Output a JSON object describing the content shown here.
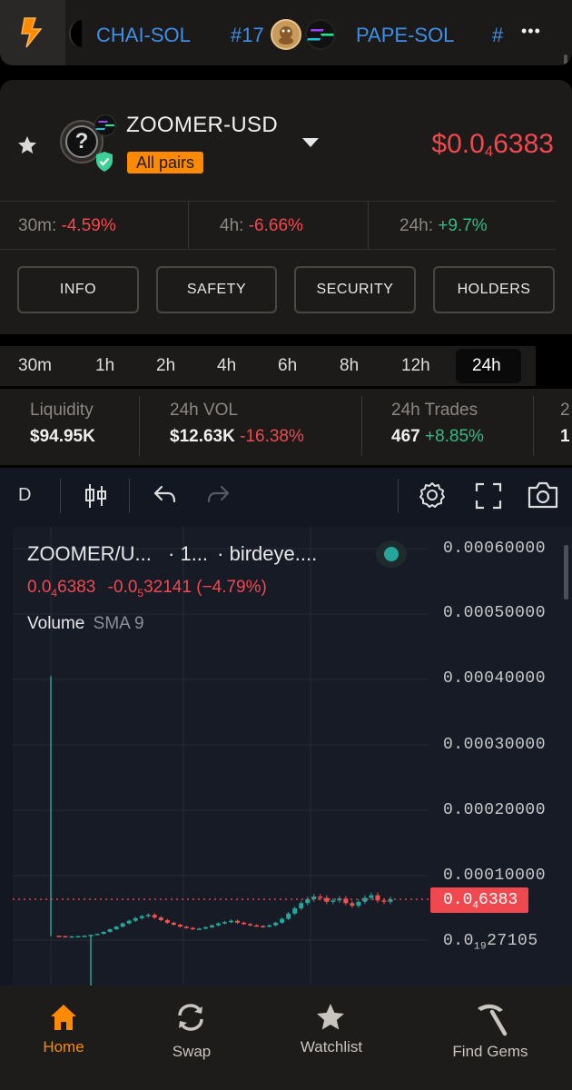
{
  "ticker": {
    "items": [
      {
        "label": "CHAI-SOL"
      },
      {
        "label": "#17"
      },
      {
        "label": "PAPE-SOL"
      },
      {
        "label": "#"
      }
    ],
    "more_label": "•••"
  },
  "pair": {
    "name": "ZOOMER-USD",
    "tag": "All pairs",
    "price": "$0.0",
    "price_sub": "4",
    "price_tail": "6383",
    "avatar_symbol": "?"
  },
  "changes": [
    {
      "label": "30m:",
      "value": "-4.59%",
      "dir": "down"
    },
    {
      "label": "4h:",
      "value": "-6.66%",
      "dir": "down"
    },
    {
      "label": "24h:",
      "value": "+9.7%",
      "dir": "up"
    }
  ],
  "actions": [
    "INFO",
    "SAFETY",
    "SECURITY",
    "HOLDERS"
  ],
  "timeframes": [
    "30m",
    "1h",
    "2h",
    "4h",
    "6h",
    "8h",
    "12h",
    "24h"
  ],
  "active_timeframe": "24h",
  "stats": [
    {
      "label": "Liquidity",
      "value": "$94.95K",
      "change": ""
    },
    {
      "label": "24h VOL",
      "value": "$12.63K",
      "change": "-16.38%",
      "dir": "down"
    },
    {
      "label": "24h Trades",
      "value": "467",
      "change": "+8.85%",
      "dir": "up"
    },
    {
      "label": "2",
      "value": "1",
      "change": ""
    }
  ],
  "chart_toolbar": {
    "interval": "D"
  },
  "chart_legend": {
    "symbol": "ZOOMER/U...",
    "interval": "· 1...",
    "source": "· birdeye....",
    "price": "0.0",
    "price_sub": "4",
    "price_tail": "6383",
    "change": "-0.0",
    "change_sub": "5",
    "change_tail": "32141 (−4.79%)",
    "volume_label": "Volume",
    "volume_indicator": "SMA 9"
  },
  "chart_data": {
    "type": "candlestick",
    "y_ticks": [
      "0.00060000",
      "0.00050000",
      "0.00040000",
      "0.00030000",
      "0.00020000",
      "0.00010000"
    ],
    "ylim": [
      7.9e-06,
      0.0006
    ],
    "last_price_label": {
      "main": "0.0",
      "sub": "4",
      "tail": "6383"
    },
    "last_price_value": 6.38e-05,
    "low_label": {
      "main": "0.0",
      "sub": "19",
      "tail": "27105"
    },
    "up_color": "#26a69a",
    "down_color": "#ef5350",
    "wick_high": 0.000405,
    "wick_low": -4e-05,
    "series": [
      8e-06,
      7.5e-06,
      7e-06,
      7.2e-06,
      7.5e-06,
      8.2e-06,
      9.5e-06,
      1.1e-05,
      1.4e-05,
      1.8e-05,
      2.2e-05,
      2.7e-05,
      3.1e-05,
      3.5e-05,
      3.8e-05,
      4e-05,
      3.6e-05,
      3.2e-05,
      2.8e-05,
      2.5e-05,
      2.2e-05,
      2e-05,
      1.8e-05,
      1.9e-05,
      2.1e-05,
      2.4e-05,
      2.7e-05,
      2.9e-05,
      3.1e-05,
      2.8e-05,
      2.6e-05,
      2.4e-05,
      2.3e-05,
      2.2e-05,
      2.4e-05,
      2.8e-05,
      3.4e-05,
      4.2e-05,
      5e-05,
      5.8e-05,
      6.4e-05,
      6.8e-05,
      6.6e-05,
      6e-05,
      6.2e-05,
      6.5e-05,
      5.8e-05,
      5.4e-05,
      6e-05,
      6.6e-05,
      7e-05,
      6.2e-05,
      6e-05,
      6.4e-05
    ]
  },
  "colors": {
    "red": "#f0484f",
    "green": "#2ebd85",
    "orange": "#ff8a00",
    "blue": "#3d8fe8"
  },
  "nav": [
    {
      "label": "Home",
      "icon": "home-icon",
      "active": true
    },
    {
      "label": "Swap",
      "icon": "swap-icon",
      "active": false
    },
    {
      "label": "Watchlist",
      "icon": "star-icon",
      "active": false
    },
    {
      "label": "Find Gems",
      "icon": "pickaxe-icon",
      "active": false
    }
  ]
}
